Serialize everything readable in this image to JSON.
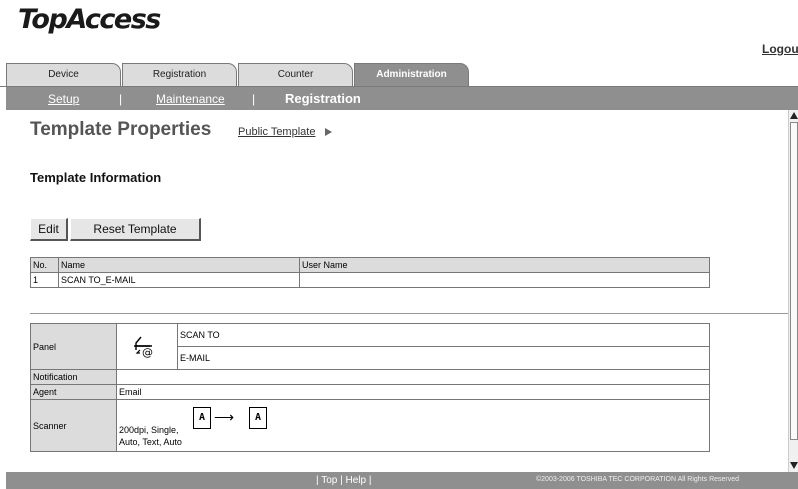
{
  "app": {
    "logo": "TopAccess",
    "logout": "Logou"
  },
  "tabs": [
    {
      "label": "Device"
    },
    {
      "label": "Registration"
    },
    {
      "label": "Counter"
    },
    {
      "label": "Administration"
    }
  ],
  "subnav": {
    "setup": "Setup",
    "maintenance": "Maintenance",
    "sep": "|",
    "current": "Registration"
  },
  "page": {
    "title": "Template Properties",
    "breadcrumb_link": "Public Template",
    "section_title": "Template Information"
  },
  "buttons": {
    "edit": "Edit",
    "reset": "Reset Template"
  },
  "info_table": {
    "headers": {
      "no": "No.",
      "name": "Name",
      "user": "User Name"
    },
    "row": {
      "no": "1",
      "name": "SCAN TO_E-MAIL",
      "user": ""
    }
  },
  "detail": {
    "panel_label": "Panel",
    "panel_line1": "SCAN TO",
    "panel_line2": "E-MAIL",
    "panel_icon": "scan-to-email-icon",
    "notification_label": "Notification",
    "notification_value": "",
    "agent_label": "Agent",
    "agent_value": "Email",
    "scanner_label": "Scanner",
    "scanner_text1": "200dpi, Single,",
    "scanner_text2": "Auto, Text, Auto",
    "scanner_icon_letter": "A",
    "scanner_arrow": "⟶"
  },
  "footer": {
    "top": "Top",
    "help": "Help",
    "bar": "|",
    "copyright": "©2003-2006 TOSHIBA TEC CORPORATION All Rights Reserved"
  },
  "colors": {
    "nav_gray": "#8f8f8f",
    "tab_gray": "#dcdcdc",
    "header_cell": "#dcdcdc"
  }
}
